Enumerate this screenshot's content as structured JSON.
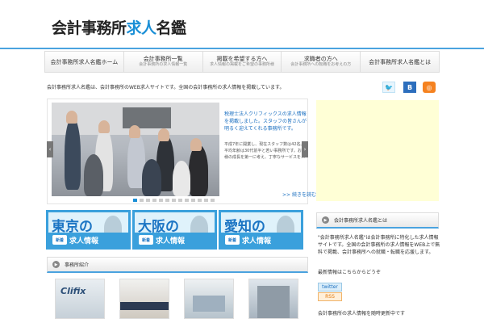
{
  "site": {
    "logo_prefix": "会計事務所",
    "logo_accent": "求人",
    "logo_suffix": "名鑑"
  },
  "nav": [
    {
      "title": "会計事務所求人名鑑ホーム",
      "sub": ""
    },
    {
      "title": "会計事務所一覧",
      "sub": "会計事務所の求人情報一覧"
    },
    {
      "title": "掲載を希望する方へ",
      "sub": "求人情報の掲載をご希望の事務所様"
    },
    {
      "title": "求職者の方へ",
      "sub": "会計事務所への転職をお考えの方"
    },
    {
      "title": "会計事務所求人名鑑とは",
      "sub": ""
    }
  ],
  "intro": "会計事務所求人名鑑は、会計事務所のWEB求人サイトです。全国の会計事務所の求人情報を掲載しています。",
  "social": [
    {
      "name": "twitter-icon",
      "glyph": "🐦",
      "color": "#e8f5fd"
    },
    {
      "name": "hatena-bookmark-icon",
      "glyph": "B",
      "color": "#2c6ebd"
    },
    {
      "name": "rss-icon",
      "glyph": "◎",
      "color": "#f58220"
    }
  ],
  "slider": {
    "title": "税理士法人クリフィックスの求人情報を掲載しました。スタッフの皆さんが明るく迎えてくれる事務所です。",
    "body": "平成7年に開業し、現在スタッフ数は42名。平均年齢は30代前半と若い事務所です。お客様の成長を第一に考え、丁寧なサービスを…",
    "more": ">> 続きを読む",
    "dots": 13,
    "active_dot": 0
  },
  "regions": [
    {
      "city": "東京の",
      "new": "新着",
      "label": "求人情報"
    },
    {
      "city": "大阪の",
      "new": "新着",
      "label": "求人情報"
    },
    {
      "city": "愛知の",
      "new": "新着",
      "label": "求人情報"
    }
  ],
  "photos_section": {
    "label": "事務所紹介"
  },
  "sidebar": {
    "section_label": "会計事務所求人名鑑とは",
    "desc": "\"会計事務所求人名鑑\"は会計事務所に特化した求人情報サイトです。全国の会計事務所の求人情報をWEB上で無料で掲載、会計事務所への就職・転職を応援します。",
    "follow": "最新情報はこちらからどうぞ",
    "twitter_label": "twitter",
    "rss_label": "RSS",
    "footer_text": "会計事務所の求人情報を随時更新中です"
  },
  "colors": {
    "accent": "#1a8fd6",
    "ad_bg": "#ffffd6"
  }
}
